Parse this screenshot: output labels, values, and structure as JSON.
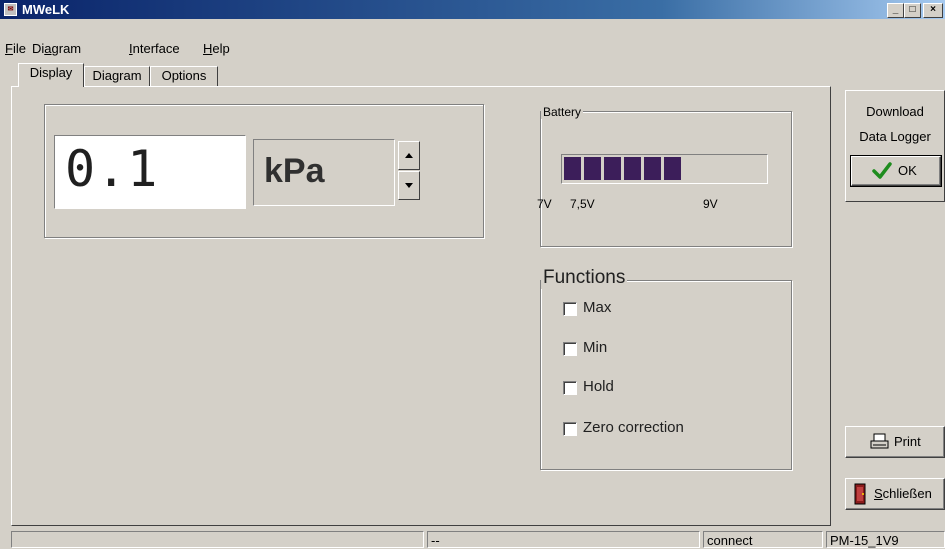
{
  "window": {
    "title": "MWeLK",
    "app_icon_text": "✉",
    "controls": {
      "minimize": "_",
      "maximize": "□",
      "close": "×"
    }
  },
  "menu": [
    {
      "label": "File",
      "underline": "F",
      "rest": "ile"
    },
    {
      "label": "Diagram",
      "underline": "a",
      "prefix": "Di",
      "rest": "gram"
    },
    {
      "label": "Interface",
      "underline": "I",
      "rest": "nterface"
    },
    {
      "label": "Help",
      "underline": "H",
      "rest": "elp"
    }
  ],
  "tabs": [
    {
      "label": "Display",
      "active": true
    },
    {
      "label": "Diagram",
      "active": false
    },
    {
      "label": "Options",
      "active": false
    }
  ],
  "display": {
    "value": "0.1",
    "unit": "kPa"
  },
  "battery": {
    "label": "Battery",
    "level_segments": 6,
    "total_segments": 12,
    "scale_labels": [
      "7V",
      "7,5V",
      "9V"
    ],
    "bar_color": "#3c1e5a"
  },
  "functions": {
    "label": "Functions",
    "items": [
      {
        "label": "Max",
        "checked": false
      },
      {
        "label": "Min",
        "checked": false
      },
      {
        "label": "Hold",
        "checked": false
      },
      {
        "label": "Zero correction",
        "checked": false
      }
    ]
  },
  "side": {
    "download_line1": "Download",
    "download_line2": "Data Logger",
    "ok_label": "OK",
    "print_label": "Print",
    "close_label": "Schließen",
    "close_underline": "S",
    "close_rest": "chließen"
  },
  "statusbar": {
    "cell1": "",
    "cell2": "--",
    "cell3": "connect",
    "cell4": "PM-15_1V9"
  },
  "colors": {
    "accent_check": "#1e8c1e",
    "title_gradient_start": "#0a246a"
  }
}
